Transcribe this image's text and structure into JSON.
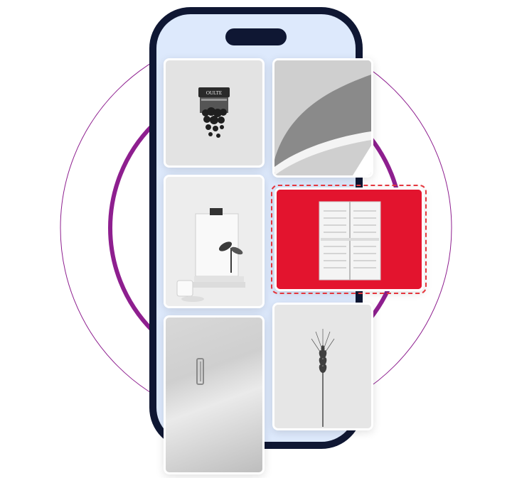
{
  "illustration": {
    "phone_color": "#0f1733",
    "screen_color": "#dde9fc",
    "ring_color": "#8e1f8f",
    "selection_color": "#e5363d",
    "accent_photo_color": "#e3142e"
  },
  "shop_sign_text": "OULTE",
  "tiles": [
    {
      "name": "hanging-plant-photo"
    },
    {
      "name": "architecture-curve-photo"
    },
    {
      "name": "clipboard-still-life-photo"
    },
    {
      "name": "red-wall-shutter-photo",
      "selected": true
    },
    {
      "name": "white-door-photo"
    },
    {
      "name": "wheat-stalk-photo"
    }
  ]
}
